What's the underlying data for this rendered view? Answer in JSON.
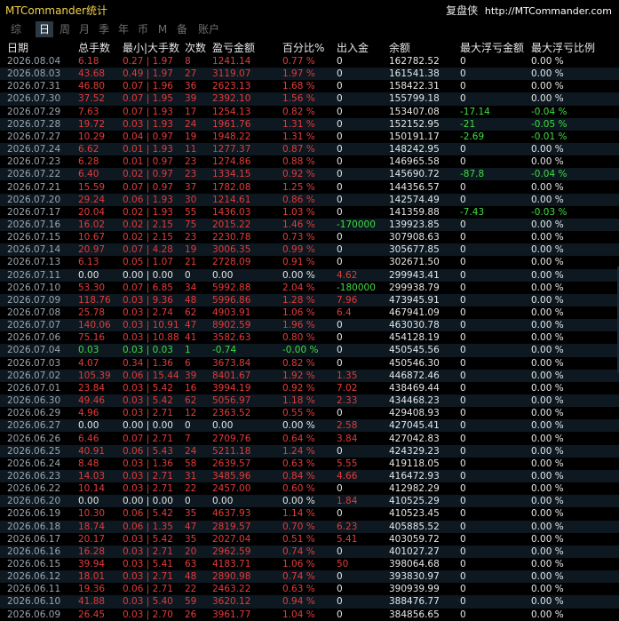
{
  "title": "MTCommander统计",
  "brand": "复盘侠",
  "url": "http://MTCommander.com",
  "tabs": [
    "综",
    "日",
    "周",
    "月",
    "季",
    "年",
    "币",
    "M",
    "备",
    "账户"
  ],
  "active_tab": 1,
  "columns": [
    "日期",
    "总手数",
    "最小|大手数",
    "次数",
    "盈亏金额",
    "百分比%",
    "出入金",
    "余额",
    "最大浮亏金额",
    "最大浮亏比例"
  ],
  "rows": [
    [
      "2026.08.04",
      "6.18",
      "0.27 | 1.97",
      "8",
      "1241.14",
      "0.77 %",
      "0",
      "162782.52",
      "0",
      "0.00 %"
    ],
    [
      "2026.08.03",
      "43.68",
      "0.49 | 1.97",
      "27",
      "3119.07",
      "1.97 %",
      "0",
      "161541.38",
      "0",
      "0.00 %"
    ],
    [
      "2026.07.31",
      "46.80",
      "0.07 | 1.96",
      "36",
      "2623.13",
      "1.68 %",
      "0",
      "158422.31",
      "0",
      "0.00 %"
    ],
    [
      "2026.07.30",
      "37.52",
      "0.07 | 1.95",
      "39",
      "2392.10",
      "1.56 %",
      "0",
      "155799.18",
      "0",
      "0.00 %"
    ],
    [
      "2026.07.29",
      "7.63",
      "0.07 | 1.93",
      "17",
      "1254.13",
      "0.82 %",
      "0",
      "153407.08",
      "-17.14",
      "-0.04 %"
    ],
    [
      "2026.07.28",
      "19.72",
      "0.03 | 1.93",
      "24",
      "1961.76",
      "1.31 %",
      "0",
      "152152.95",
      "-21",
      "-0.05 %"
    ],
    [
      "2026.07.27",
      "10.29",
      "0.04 | 0.97",
      "19",
      "1948.22",
      "1.31 %",
      "0",
      "150191.17",
      "-2.69",
      "-0.01 %"
    ],
    [
      "2026.07.24",
      "6.62",
      "0.01 | 1.93",
      "11",
      "1277.37",
      "0.87 %",
      "0",
      "148242.95",
      "0",
      "0.00 %"
    ],
    [
      "2026.07.23",
      "6.28",
      "0.01 | 0.97",
      "23",
      "1274.86",
      "0.88 %",
      "0",
      "146965.58",
      "0",
      "0.00 %"
    ],
    [
      "2026.07.22",
      "6.40",
      "0.02 | 0.97",
      "23",
      "1334.15",
      "0.92 %",
      "0",
      "145690.72",
      "-87.8",
      "-0.04 %"
    ],
    [
      "2026.07.21",
      "15.59",
      "0.07 | 0.97",
      "37",
      "1782.08",
      "1.25 %",
      "0",
      "144356.57",
      "0",
      "0.00 %"
    ],
    [
      "2026.07.20",
      "29.24",
      "0.06 | 1.93",
      "30",
      "1214.61",
      "0.86 %",
      "0",
      "142574.49",
      "0",
      "0.00 %"
    ],
    [
      "2026.07.17",
      "20.04",
      "0.02 | 1.93",
      "55",
      "1436.03",
      "1.03 %",
      "0",
      "141359.88",
      "-7.43",
      "-0.03 %"
    ],
    [
      "2026.07.16",
      "16.02",
      "0.02 | 2.15",
      "75",
      "2015.22",
      "1.46 %",
      "-170000",
      "139923.85",
      "0",
      "0.00 %"
    ],
    [
      "2026.07.15",
      "10.67",
      "0.02 | 2.15",
      "23",
      "2230.78",
      "0.73 %",
      "0",
      "307908.63",
      "0",
      "0.00 %"
    ],
    [
      "2026.07.14",
      "20.97",
      "0.07 | 4.28",
      "19",
      "3006.35",
      "0.99 %",
      "0",
      "305677.85",
      "0",
      "0.00 %"
    ],
    [
      "2026.07.13",
      "6.13",
      "0.05 | 1.07",
      "21",
      "2728.09",
      "0.91 %",
      "0",
      "302671.50",
      "0",
      "0.00 %"
    ],
    [
      "2026.07.11",
      "0.00",
      "0.00 | 0.00",
      "0",
      "0.00",
      "0.00 %",
      "4.62",
      "299943.41",
      "0",
      "0.00 %"
    ],
    [
      "2026.07.10",
      "53.30",
      "0.07 | 6.85",
      "34",
      "5992.88",
      "2.04 %",
      "-180000",
      "299938.79",
      "0",
      "0.00 %"
    ],
    [
      "2026.07.09",
      "118.76",
      "0.03 | 9.36",
      "48",
      "5996.86",
      "1.28 %",
      "7.96",
      "473945.91",
      "0",
      "0.00 %"
    ],
    [
      "2026.07.08",
      "25.78",
      "0.03 | 2.74",
      "62",
      "4903.91",
      "1.06 %",
      "6.4",
      "467941.09",
      "0",
      "0.00 %"
    ],
    [
      "2026.07.07",
      "140.06",
      "0.03 | 10.91",
      "47",
      "8902.59",
      "1.96 %",
      "0",
      "463030.78",
      "0",
      "0.00 %"
    ],
    [
      "2026.07.06",
      "75.16",
      "0.03 | 10.88",
      "41",
      "3582.63",
      "0.80 %",
      "0",
      "454128.19",
      "0",
      "0.00 %"
    ],
    [
      "2026.07.04",
      "0.03",
      "0.03 | 0.03",
      "1",
      "-0.74",
      "-0.00 %",
      "0",
      "450545.56",
      "0",
      "0.00 %"
    ],
    [
      "2026.07.03",
      "4.07",
      "0.34 | 1.36",
      "6",
      "3673.84",
      "0.82 %",
      "0",
      "450546.30",
      "0",
      "0.00 %"
    ],
    [
      "2026.07.02",
      "105.39",
      "0.06 | 15.44",
      "39",
      "8401.67",
      "1.92 %",
      "1.35",
      "446872.46",
      "0",
      "0.00 %"
    ],
    [
      "2026.07.01",
      "23.84",
      "0.03 | 5.42",
      "16",
      "3994.19",
      "0.92 %",
      "7.02",
      "438469.44",
      "0",
      "0.00 %"
    ],
    [
      "2026.06.30",
      "49.46",
      "0.03 | 5.42",
      "62",
      "5056.97",
      "1.18 %",
      "2.33",
      "434468.23",
      "0",
      "0.00 %"
    ],
    [
      "2026.06.29",
      "4.96",
      "0.03 | 2.71",
      "12",
      "2363.52",
      "0.55 %",
      "0",
      "429408.93",
      "0",
      "0.00 %"
    ],
    [
      "2026.06.27",
      "0.00",
      "0.00 | 0.00",
      "0",
      "0.00",
      "0.00 %",
      "2.58",
      "427045.41",
      "0",
      "0.00 %"
    ],
    [
      "2026.06.26",
      "6.46",
      "0.07 | 2.71",
      "7",
      "2709.76",
      "0.64 %",
      "3.84",
      "427042.83",
      "0",
      "0.00 %"
    ],
    [
      "2026.06.25",
      "40.91",
      "0.06 | 5.43",
      "24",
      "5211.18",
      "1.24 %",
      "0",
      "424329.23",
      "0",
      "0.00 %"
    ],
    [
      "2026.06.24",
      "8.48",
      "0.03 | 1.36",
      "58",
      "2639.57",
      "0.63 %",
      "5.55",
      "419118.05",
      "0",
      "0.00 %"
    ],
    [
      "2026.06.23",
      "14.03",
      "0.03 | 2.71",
      "31",
      "3485.96",
      "0.84 %",
      "4.66",
      "416472.93",
      "0",
      "0.00 %"
    ],
    [
      "2026.06.22",
      "10.14",
      "0.03 | 2.71",
      "22",
      "2457.00",
      "0.60 %",
      "0",
      "412982.29",
      "0",
      "0.00 %"
    ],
    [
      "2026.06.20",
      "0.00",
      "0.00 | 0.00",
      "0",
      "0.00",
      "0.00 %",
      "1.84",
      "410525.29",
      "0",
      "0.00 %"
    ],
    [
      "2026.06.19",
      "10.30",
      "0.06 | 5.42",
      "35",
      "4637.93",
      "1.14 %",
      "0",
      "410523.45",
      "0",
      "0.00 %"
    ],
    [
      "2026.06.18",
      "18.74",
      "0.06 | 1.35",
      "47",
      "2819.57",
      "0.70 %",
      "6.23",
      "405885.52",
      "0",
      "0.00 %"
    ],
    [
      "2026.06.17",
      "20.17",
      "0.03 | 5.42",
      "35",
      "2027.04",
      "0.51 %",
      "5.41",
      "403059.72",
      "0",
      "0.00 %"
    ],
    [
      "2026.06.16",
      "16.28",
      "0.03 | 2.71",
      "20",
      "2962.59",
      "0.74 %",
      "0",
      "401027.27",
      "0",
      "0.00 %"
    ],
    [
      "2026.06.15",
      "39.94",
      "0.03 | 5.41",
      "63",
      "4183.71",
      "1.06 %",
      "50",
      "398064.68",
      "0",
      "0.00 %"
    ],
    [
      "2026.06.12",
      "18.01",
      "0.03 | 2.71",
      "48",
      "2890.98",
      "0.74 %",
      "0",
      "393830.97",
      "0",
      "0.00 %"
    ],
    [
      "2026.06.11",
      "19.36",
      "0.06 | 2.71",
      "22",
      "2463.22",
      "0.63 %",
      "0",
      "390939.99",
      "0",
      "0.00 %"
    ],
    [
      "2026.06.10",
      "41.88",
      "0.03 | 5.40",
      "59",
      "3620.12",
      "0.94 %",
      "0",
      "388476.77",
      "0",
      "0.00 %"
    ],
    [
      "2026.06.09",
      "26.45",
      "0.03 | 2.70",
      "26",
      "3961.77",
      "1.04 %",
      "0",
      "384856.65",
      "0",
      "0.00 %"
    ]
  ]
}
